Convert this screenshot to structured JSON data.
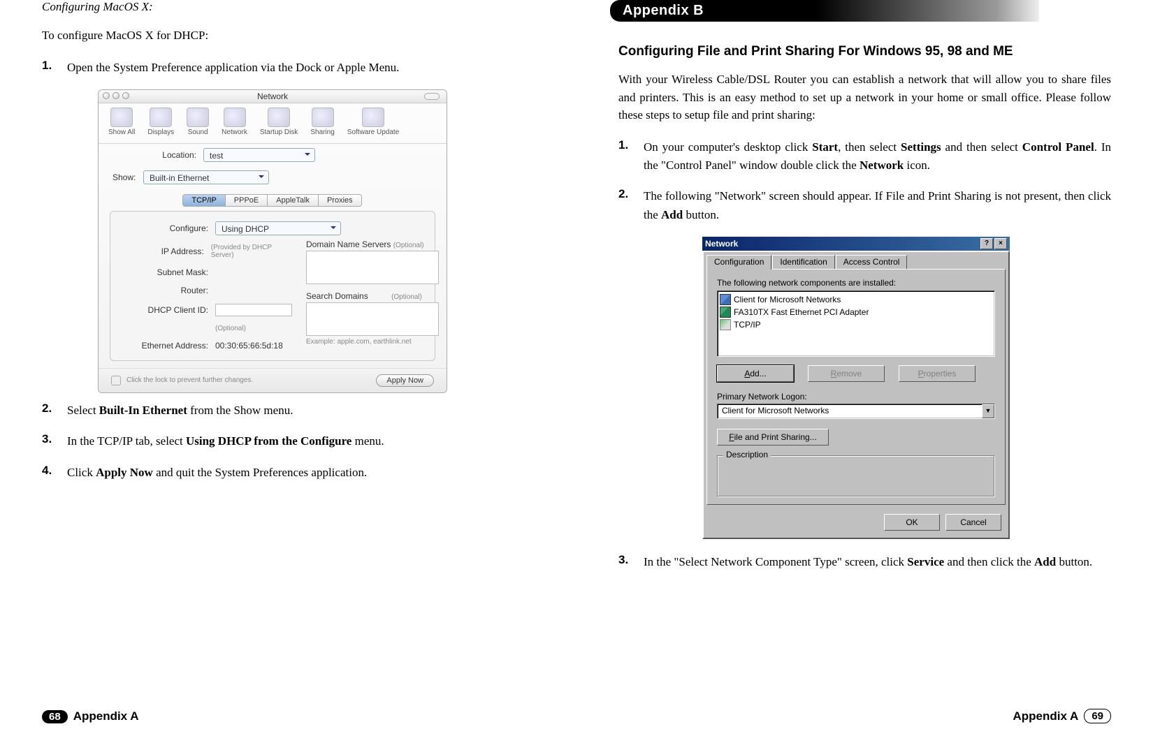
{
  "left": {
    "section_title": "Configuring MacOS X:",
    "intro": "To configure MacOS X for DHCP:",
    "step1_num": "1.",
    "step1": "Open the System Preference application via the Dock or Apple Menu.",
    "step2_num": "2.",
    "step2_pre": "Select ",
    "step2_b": "Built-In Ethernet",
    "step2_post": " from the Show menu.",
    "step3_num": "3.",
    "step3_pre": "In the TCP/IP tab, select ",
    "step3_b": "Using DHCP from the Configure",
    "step3_post": " menu.",
    "step4_num": "4.",
    "step4_pre": "Click ",
    "step4_b": "Apply Now",
    "step4_post": " and quit the System Preferences application.",
    "mac": {
      "title": "Network",
      "tb": {
        "a": "Show All",
        "b": "Displays",
        "c": "Sound",
        "d": "Network",
        "e": "Startup Disk",
        "f": "Sharing",
        "g": "Software Update"
      },
      "loc_lbl": "Location:",
      "loc_val": "test",
      "show_lbl": "Show:",
      "show_val": "Built-in Ethernet",
      "tab_a": "TCP/IP",
      "tab_b": "PPPoE",
      "tab_c": "AppleTalk",
      "tab_d": "Proxies",
      "conf_lbl": "Configure:",
      "conf_val": "Using DHCP",
      "ip_lbl": "IP Address:",
      "ip_note": "(Provided by DHCP Server)",
      "sub_lbl": "Subnet Mask:",
      "rout_lbl": "Router:",
      "dhcp_lbl": "DHCP Client ID:",
      "dhcp_opt": "(Optional)",
      "eth_lbl": "Ethernet Address:",
      "eth_val": "00:30:65:66:5d:18",
      "dns_lbl": "Domain Name Servers",
      "dns_opt": "(Optional)",
      "sd_lbl": "Search Domains",
      "sd_opt": "(Optional)",
      "sd_ex": "Example: apple.com, earthlink.net",
      "lock": "Click the lock to prevent further changes.",
      "apply": "Apply Now"
    },
    "foot_page": "68",
    "foot_label": "Appendix A"
  },
  "right": {
    "badge": "Appendix B",
    "heading": "Configuring File and Print Sharing For Windows 95, 98 and ME",
    "intro": "With your Wireless Cable/DSL Router you can establish a network that will allow you to share files and printers. This is an easy method to set up a network in your home or small office. Please follow these steps to setup file and print sharing:",
    "s1_num": "1.",
    "s1_a": "On your computer's desktop click ",
    "s1_b1": "Start",
    "s1_c": ", then select ",
    "s1_b2": "Settings",
    "s1_d": " and then select ",
    "s1_b3": "Control Panel",
    "s1_e": ". In the \"Control Panel\" window double click the ",
    "s1_b4": "Network",
    "s1_f": " icon.",
    "s2_num": "2.",
    "s2_a": "The following \"Network\" screen should appear. If File and Print Sharing is not present, then click the ",
    "s2_b": "Add",
    "s2_c": " button.",
    "s3_num": "3.",
    "s3_a": "In the \"Select Network Component Type\" screen, click ",
    "s3_b1": "Service",
    "s3_c": " and then click the ",
    "s3_b2": "Add",
    "s3_d": " button.",
    "win": {
      "title": "Network",
      "help": "?",
      "close": "×",
      "tab_a": "Configuration",
      "tab_b": "Identification",
      "tab_c": "Access Control",
      "list_lbl": "The following network components are installed:",
      "it_a": "Client for Microsoft Networks",
      "it_b": "FA310TX Fast Ethernet PCI Adapter",
      "it_c": "TCP/IP",
      "btn_add_u": "A",
      "btn_add_r": "dd...",
      "btn_rm_u": "R",
      "btn_rm_r": "emove",
      "btn_pr_u": "P",
      "btn_pr_r": "roperties",
      "logon_lbl": "Primary Network Logon:",
      "logon_val": "Client for Microsoft Networks",
      "fps_u": "F",
      "fps_r": "ile and Print Sharing...",
      "group": "Description",
      "ok": "OK",
      "cancel": "Cancel"
    },
    "foot_label": "Appendix A",
    "foot_page": "69"
  }
}
